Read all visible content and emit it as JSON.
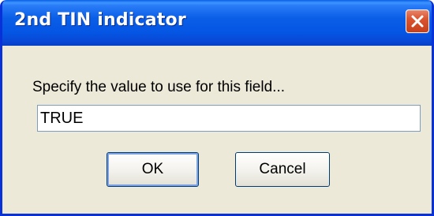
{
  "dialog": {
    "title": "2nd TIN indicator",
    "prompt": "Specify the value to use for this field...",
    "value": "TRUE",
    "ok_label": "OK",
    "cancel_label": "Cancel",
    "close_icon": "close-icon"
  },
  "colors": {
    "titlebar": "#0a5ee6",
    "frame": "#0831d9",
    "body": "#ece9d8",
    "close_button": "#d9542f"
  }
}
